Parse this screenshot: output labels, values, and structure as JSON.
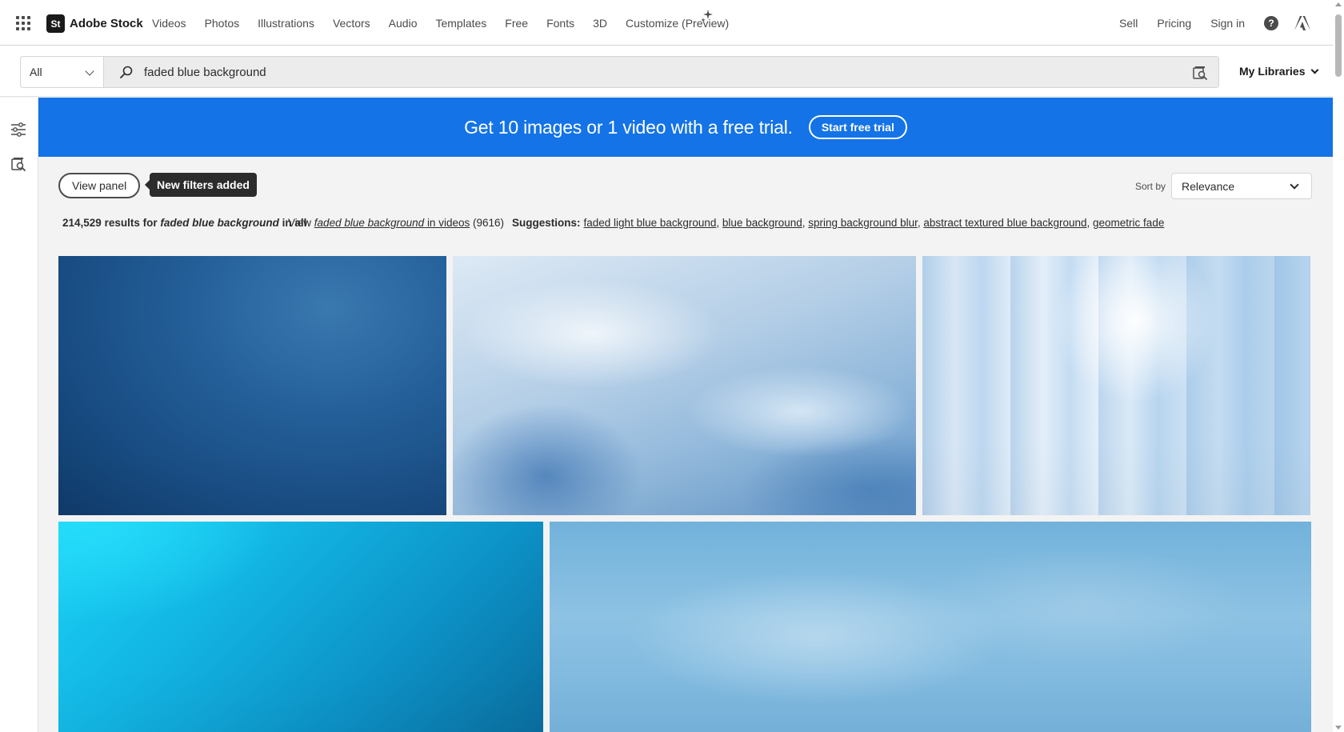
{
  "header": {
    "brand_mark": "St",
    "brand_name": "Adobe Stock",
    "nav": [
      "Videos",
      "Photos",
      "Illustrations",
      "Vectors",
      "Audio",
      "Templates",
      "Free",
      "Fonts",
      "3D",
      "Customize (Preview)"
    ],
    "right_nav": [
      "Sell",
      "Pricing",
      "Sign in"
    ],
    "icons": [
      "apps-grid-icon",
      "sparkle-icon",
      "help-icon",
      "adobe-logo-icon"
    ]
  },
  "search": {
    "type_selected": "All",
    "query": "faded blue background",
    "libraries_label": "My Libraries"
  },
  "banner": {
    "text": "Get 10 images or 1 video with a free trial.",
    "cta": "Start free trial",
    "color": "#1473e6"
  },
  "toolbar": {
    "view_panel": "View panel",
    "tooltip": "New filters added",
    "sort_label": "Sort by",
    "sort_value": "Relevance"
  },
  "results": {
    "count": "214,529",
    "for_text": "results for",
    "query": "faded blue background",
    "in_text": "in all",
    "view_prefix": "View",
    "view_query": "faded blue background",
    "view_suffix": "in videos",
    "video_count": "(9616)",
    "suggestions_label": "Suggestions:",
    "suggestions": [
      "faded light blue background",
      "blue background",
      "spring background blur",
      "abstract textured blue background",
      "geometric fade"
    ]
  },
  "images": [
    {
      "alt": "dark blue gradient background"
    },
    {
      "alt": "light blue smoke waves"
    },
    {
      "alt": "blurred pale blue vertical light"
    },
    {
      "alt": "bright cyan to teal gradient"
    },
    {
      "alt": "soft watercolor sky blue texture"
    }
  ]
}
